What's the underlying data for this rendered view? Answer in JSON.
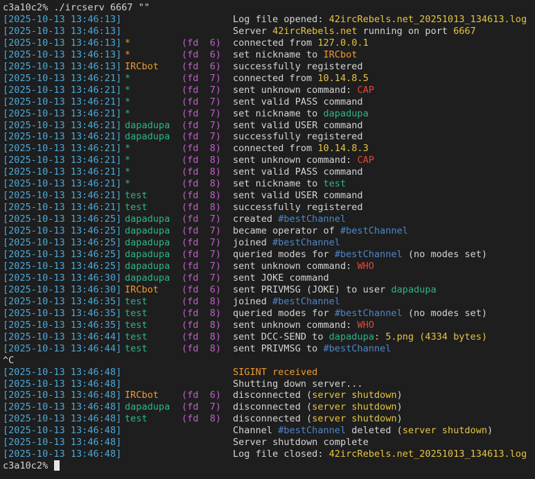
{
  "colors": {
    "background": "#1e1e1e",
    "text": "#d4d4d4",
    "timestamp": "#4ca8d8",
    "fd": "#c15fc8",
    "yellow": "#e5c441",
    "orange": "#f09a2a",
    "green": "#2ab58a",
    "blue": "#4d86c8",
    "red": "#e0473a"
  },
  "command_line": "c3a10c2% ./ircserv 6667 \"\"",
  "lines": [
    {
      "ts": "[2025-10-13 13:46:13]",
      "who": "",
      "who_color": "plain",
      "fd": "",
      "msg": [
        {
          "t": "Log file opened: ",
          "c": "plain"
        },
        {
          "t": "42ircRebels.net_20251013_134613.log",
          "c": "yellow"
        }
      ]
    },
    {
      "ts": "[2025-10-13 13:46:13]",
      "who": "",
      "who_color": "plain",
      "fd": "",
      "msg": [
        {
          "t": "Server ",
          "c": "plain"
        },
        {
          "t": "42ircRebels.net",
          "c": "yellow"
        },
        {
          "t": " running on port ",
          "c": "plain"
        },
        {
          "t": "6667",
          "c": "yellow"
        }
      ]
    },
    {
      "ts": "[2025-10-13 13:46:13]",
      "who": "*",
      "who_color": "orange",
      "fd": "(fd  6)",
      "msg": [
        {
          "t": "connected from ",
          "c": "plain"
        },
        {
          "t": "127.0.0.1",
          "c": "yellow"
        }
      ]
    },
    {
      "ts": "[2025-10-13 13:46:13]",
      "who": "*",
      "who_color": "orange",
      "fd": "(fd  6)",
      "msg": [
        {
          "t": "set nickname to ",
          "c": "plain"
        },
        {
          "t": "IRCbot",
          "c": "orange"
        }
      ]
    },
    {
      "ts": "[2025-10-13 13:46:13]",
      "who": "IRCbot",
      "who_color": "orange",
      "fd": "(fd  6)",
      "msg": [
        {
          "t": "successfully registered",
          "c": "plain"
        }
      ]
    },
    {
      "ts": "[2025-10-13 13:46:21]",
      "who": "*",
      "who_color": "green",
      "fd": "(fd  7)",
      "msg": [
        {
          "t": "connected from ",
          "c": "plain"
        },
        {
          "t": "10.14.8.5",
          "c": "yellow"
        }
      ]
    },
    {
      "ts": "[2025-10-13 13:46:21]",
      "who": "*",
      "who_color": "green",
      "fd": "(fd  7)",
      "msg": [
        {
          "t": "sent unknown command: ",
          "c": "plain"
        },
        {
          "t": "CAP",
          "c": "red"
        }
      ]
    },
    {
      "ts": "[2025-10-13 13:46:21]",
      "who": "*",
      "who_color": "green",
      "fd": "(fd  7)",
      "msg": [
        {
          "t": "sent valid PASS command",
          "c": "plain"
        }
      ]
    },
    {
      "ts": "[2025-10-13 13:46:21]",
      "who": "*",
      "who_color": "green",
      "fd": "(fd  7)",
      "msg": [
        {
          "t": "set nickname to ",
          "c": "plain"
        },
        {
          "t": "dapadupa",
          "c": "green"
        }
      ]
    },
    {
      "ts": "[2025-10-13 13:46:21]",
      "who": "dapadupa",
      "who_color": "green",
      "fd": "(fd  7)",
      "msg": [
        {
          "t": "sent valid USER command",
          "c": "plain"
        }
      ]
    },
    {
      "ts": "[2025-10-13 13:46:21]",
      "who": "dapadupa",
      "who_color": "green",
      "fd": "(fd  7)",
      "msg": [
        {
          "t": "successfully registered",
          "c": "plain"
        }
      ]
    },
    {
      "ts": "[2025-10-13 13:46:21]",
      "who": "*",
      "who_color": "green",
      "fd": "(fd  8)",
      "msg": [
        {
          "t": "connected from ",
          "c": "plain"
        },
        {
          "t": "10.14.8.3",
          "c": "yellow"
        }
      ]
    },
    {
      "ts": "[2025-10-13 13:46:21]",
      "who": "*",
      "who_color": "green",
      "fd": "(fd  8)",
      "msg": [
        {
          "t": "sent unknown command: ",
          "c": "plain"
        },
        {
          "t": "CAP",
          "c": "red"
        }
      ]
    },
    {
      "ts": "[2025-10-13 13:46:21]",
      "who": "*",
      "who_color": "green",
      "fd": "(fd  8)",
      "msg": [
        {
          "t": "sent valid PASS command",
          "c": "plain"
        }
      ]
    },
    {
      "ts": "[2025-10-13 13:46:21]",
      "who": "*",
      "who_color": "green",
      "fd": "(fd  8)",
      "msg": [
        {
          "t": "set nickname to ",
          "c": "plain"
        },
        {
          "t": "test",
          "c": "green"
        }
      ]
    },
    {
      "ts": "[2025-10-13 13:46:21]",
      "who": "test",
      "who_color": "green",
      "fd": "(fd  8)",
      "msg": [
        {
          "t": "sent valid USER command",
          "c": "plain"
        }
      ]
    },
    {
      "ts": "[2025-10-13 13:46:21]",
      "who": "test",
      "who_color": "green",
      "fd": "(fd  8)",
      "msg": [
        {
          "t": "successfully registered",
          "c": "plain"
        }
      ]
    },
    {
      "ts": "[2025-10-13 13:46:25]",
      "who": "dapadupa",
      "who_color": "green",
      "fd": "(fd  7)",
      "msg": [
        {
          "t": "created ",
          "c": "plain"
        },
        {
          "t": "#bestChannel",
          "c": "blue"
        }
      ]
    },
    {
      "ts": "[2025-10-13 13:46:25]",
      "who": "dapadupa",
      "who_color": "green",
      "fd": "(fd  7)",
      "msg": [
        {
          "t": "became operator of ",
          "c": "plain"
        },
        {
          "t": "#bestChannel",
          "c": "blue"
        }
      ]
    },
    {
      "ts": "[2025-10-13 13:46:25]",
      "who": "dapadupa",
      "who_color": "green",
      "fd": "(fd  7)",
      "msg": [
        {
          "t": "joined ",
          "c": "plain"
        },
        {
          "t": "#bestChannel",
          "c": "blue"
        }
      ]
    },
    {
      "ts": "[2025-10-13 13:46:25]",
      "who": "dapadupa",
      "who_color": "green",
      "fd": "(fd  7)",
      "msg": [
        {
          "t": "queried modes for ",
          "c": "plain"
        },
        {
          "t": "#bestChannel",
          "c": "blue"
        },
        {
          "t": " (no modes set)",
          "c": "plain"
        }
      ]
    },
    {
      "ts": "[2025-10-13 13:46:25]",
      "who": "dapadupa",
      "who_color": "green",
      "fd": "(fd  7)",
      "msg": [
        {
          "t": "sent unknown command: ",
          "c": "plain"
        },
        {
          "t": "WHO",
          "c": "red"
        }
      ]
    },
    {
      "ts": "[2025-10-13 13:46:30]",
      "who": "dapadupa",
      "who_color": "green",
      "fd": "(fd  7)",
      "msg": [
        {
          "t": "sent JOKE command",
          "c": "plain"
        }
      ]
    },
    {
      "ts": "[2025-10-13 13:46:30]",
      "who": "IRCbot",
      "who_color": "orange",
      "fd": "(fd  6)",
      "msg": [
        {
          "t": "sent PRIVMSG (JOKE) to user ",
          "c": "plain"
        },
        {
          "t": "dapadupa",
          "c": "green"
        }
      ]
    },
    {
      "ts": "[2025-10-13 13:46:35]",
      "who": "test",
      "who_color": "green",
      "fd": "(fd  8)",
      "msg": [
        {
          "t": "joined ",
          "c": "plain"
        },
        {
          "t": "#bestChannel",
          "c": "blue"
        }
      ]
    },
    {
      "ts": "[2025-10-13 13:46:35]",
      "who": "test",
      "who_color": "green",
      "fd": "(fd  8)",
      "msg": [
        {
          "t": "queried modes for ",
          "c": "plain"
        },
        {
          "t": "#bestChannel",
          "c": "blue"
        },
        {
          "t": " (no modes set)",
          "c": "plain"
        }
      ]
    },
    {
      "ts": "[2025-10-13 13:46:35]",
      "who": "test",
      "who_color": "green",
      "fd": "(fd  8)",
      "msg": [
        {
          "t": "sent unknown command: ",
          "c": "plain"
        },
        {
          "t": "WHO",
          "c": "red"
        }
      ]
    },
    {
      "ts": "[2025-10-13 13:46:44]",
      "who": "test",
      "who_color": "green",
      "fd": "(fd  8)",
      "msg": [
        {
          "t": "sent DCC-SEND to ",
          "c": "plain"
        },
        {
          "t": "dapadupa",
          "c": "green"
        },
        {
          "t": ": 5.png (4334 bytes)",
          "c": "yellow"
        }
      ]
    },
    {
      "ts": "[2025-10-13 13:46:44]",
      "who": "test",
      "who_color": "green",
      "fd": "(fd  8)",
      "msg": [
        {
          "t": "sent PRIVMSG to ",
          "c": "plain"
        },
        {
          "t": "#bestChannel",
          "c": "blue"
        }
      ]
    },
    {
      "raw": "^C"
    },
    {
      "ts": "[2025-10-13 13:46:48]",
      "who": "",
      "who_color": "plain",
      "fd": "",
      "msg": [
        {
          "t": "SIGINT received",
          "c": "orange"
        }
      ]
    },
    {
      "ts": "[2025-10-13 13:46:48]",
      "who": "",
      "who_color": "plain",
      "fd": "",
      "msg": [
        {
          "t": "Shutting down server...",
          "c": "plain"
        }
      ]
    },
    {
      "ts": "[2025-10-13 13:46:48]",
      "who": "IRCbot",
      "who_color": "orange",
      "fd": "(fd  6)",
      "msg": [
        {
          "t": "disconnected (",
          "c": "plain"
        },
        {
          "t": "server shutdown",
          "c": "yellow"
        },
        {
          "t": ")",
          "c": "plain"
        }
      ]
    },
    {
      "ts": "[2025-10-13 13:46:48]",
      "who": "dapadupa",
      "who_color": "green",
      "fd": "(fd  7)",
      "msg": [
        {
          "t": "disconnected (",
          "c": "plain"
        },
        {
          "t": "server shutdown",
          "c": "yellow"
        },
        {
          "t": ")",
          "c": "plain"
        }
      ]
    },
    {
      "ts": "[2025-10-13 13:46:48]",
      "who": "test",
      "who_color": "green",
      "fd": "(fd  8)",
      "msg": [
        {
          "t": "disconnected (",
          "c": "plain"
        },
        {
          "t": "server shutdown",
          "c": "yellow"
        },
        {
          "t": ")",
          "c": "plain"
        }
      ]
    },
    {
      "ts": "[2025-10-13 13:46:48]",
      "who": "",
      "who_color": "plain",
      "fd": "",
      "msg": [
        {
          "t": "Channel ",
          "c": "plain"
        },
        {
          "t": "#bestChannel",
          "c": "blue"
        },
        {
          "t": " deleted (",
          "c": "plain"
        },
        {
          "t": "server shutdown",
          "c": "yellow"
        },
        {
          "t": ")",
          "c": "plain"
        }
      ]
    },
    {
      "ts": "[2025-10-13 13:46:48]",
      "who": "",
      "who_color": "plain",
      "fd": "",
      "msg": [
        {
          "t": "Server shutdown complete",
          "c": "plain"
        }
      ]
    },
    {
      "ts": "[2025-10-13 13:46:48]",
      "who": "",
      "who_color": "plain",
      "fd": "",
      "msg": [
        {
          "t": "Log file closed: ",
          "c": "plain"
        },
        {
          "t": "42ircRebels.net_20251013_134613.log",
          "c": "yellow"
        }
      ]
    }
  ],
  "prompt": "c3a10c2% "
}
